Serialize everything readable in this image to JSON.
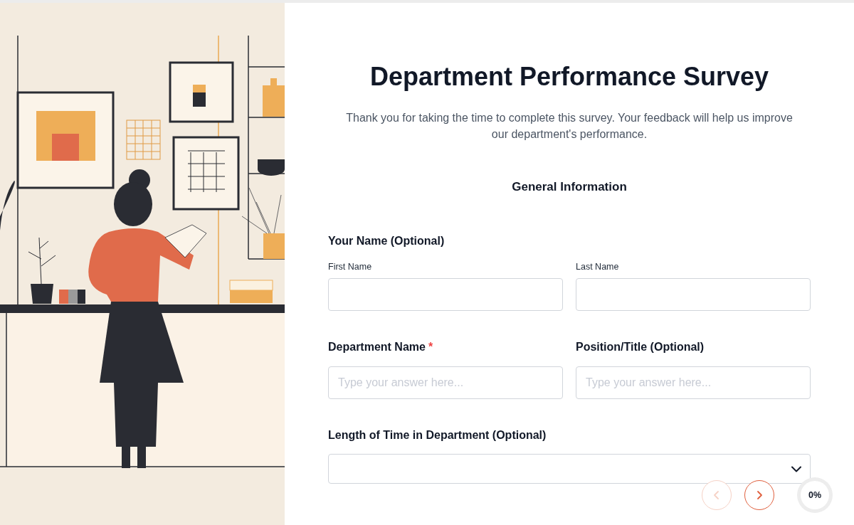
{
  "survey": {
    "title": "Department Performance Survey",
    "intro": "Thank you for taking the time to complete this survey. Your feedback will help us improve our department's performance.",
    "section": "General Information",
    "groups": [
      {
        "kind": "split",
        "label": "Your Name (Optional)",
        "inputs": [
          {
            "label": "First Name"
          },
          {
            "label": "Last Name"
          }
        ]
      },
      {
        "kind": "pair",
        "items": [
          {
            "label": "Department Name",
            "mark": "*",
            "placeholder": "Type your answer here..."
          },
          {
            "label": "Position/Title (Optional)",
            "placeholder": "Type your answer here..."
          }
        ]
      },
      {
        "kind": "select",
        "label": "Length of Time in Department (Optional)"
      }
    ]
  },
  "navigation": {
    "previous": {
      "disabled": true
    },
    "next": {
      "disabled": false
    }
  },
  "progress": {
    "label": "0%"
  }
}
